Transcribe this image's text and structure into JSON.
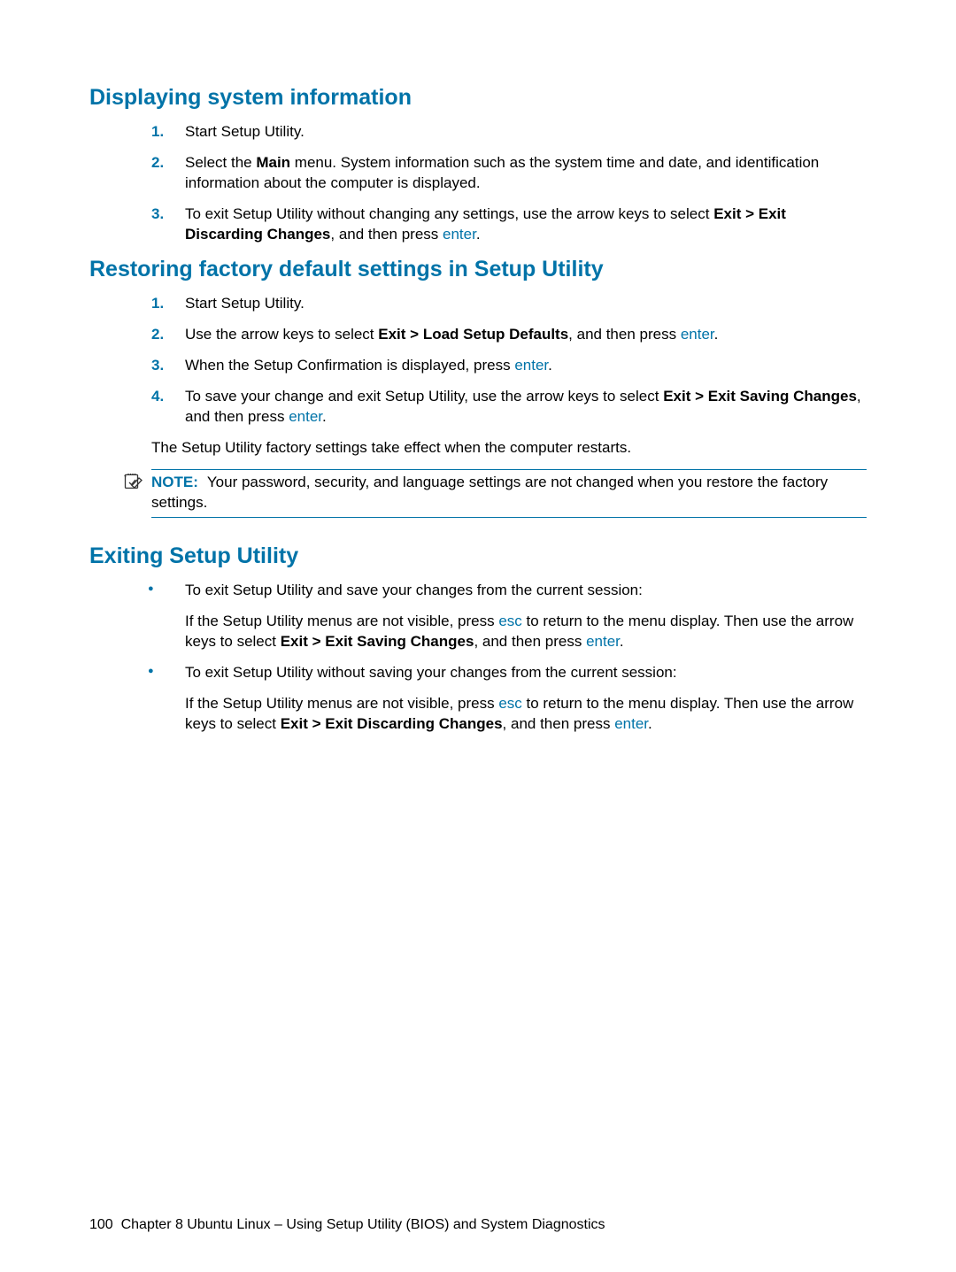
{
  "section1": {
    "heading": "Displaying system information",
    "steps": {
      "s1": {
        "num": "1.",
        "text": "Start Setup Utility."
      },
      "s2": {
        "num": "2.",
        "t1": "Select the ",
        "b1": "Main",
        "t2": " menu. System information such as the system time and date, and identification information about the computer is displayed."
      },
      "s3": {
        "num": "3.",
        "t1": "To exit Setup Utility without changing any settings, use the arrow keys to select ",
        "b1": "Exit > Exit Discarding Changes",
        "t2": ", and then press ",
        "k1": "enter",
        "t3": "."
      }
    }
  },
  "section2": {
    "heading": "Restoring factory default settings in Setup Utility",
    "steps": {
      "s1": {
        "num": "1.",
        "text": "Start Setup Utility."
      },
      "s2": {
        "num": "2.",
        "t1": "Use the arrow keys to select ",
        "b1": "Exit > Load Setup Defaults",
        "t2": ", and then press ",
        "k1": "enter",
        "t3": "."
      },
      "s3": {
        "num": "3.",
        "t1": "When the Setup Confirmation is displayed, press ",
        "k1": "enter",
        "t2": "."
      },
      "s4": {
        "num": "4.",
        "t1": "To save your change and exit Setup Utility, use the arrow keys to select ",
        "b1": "Exit > Exit Saving Changes",
        "t2": ", and then press ",
        "k1": "enter",
        "t3": "."
      }
    },
    "para": "The Setup Utility factory settings take effect when the computer restarts.",
    "note": {
      "label": "NOTE:",
      "text": "Your password, security, and language settings are not changed when you restore the factory settings."
    }
  },
  "section3": {
    "heading": "Exiting Setup Utility",
    "bullets": {
      "b1": {
        "lead": "To exit Setup Utility and save your changes from the current session:",
        "t1": "If the Setup Utility menus are not visible, press ",
        "k1": "esc",
        "t2": " to return to the menu display. Then use the arrow keys to select ",
        "bold1": "Exit > Exit Saving Changes",
        "t3": ", and then press ",
        "k2": "enter",
        "t4": "."
      },
      "b2": {
        "lead": "To exit Setup Utility without saving your changes from the current session:",
        "t1": "If the Setup Utility menus are not visible, press ",
        "k1": "esc",
        "t2": " to return to the menu display. Then use the arrow keys to select ",
        "bold1": "Exit > Exit Discarding Changes",
        "t3": ", and then press ",
        "k2": "enter",
        "t4": "."
      }
    }
  },
  "footer": {
    "page": "100",
    "chapter": "Chapter 8   Ubuntu Linux – Using Setup Utility (BIOS) and System Diagnostics"
  }
}
